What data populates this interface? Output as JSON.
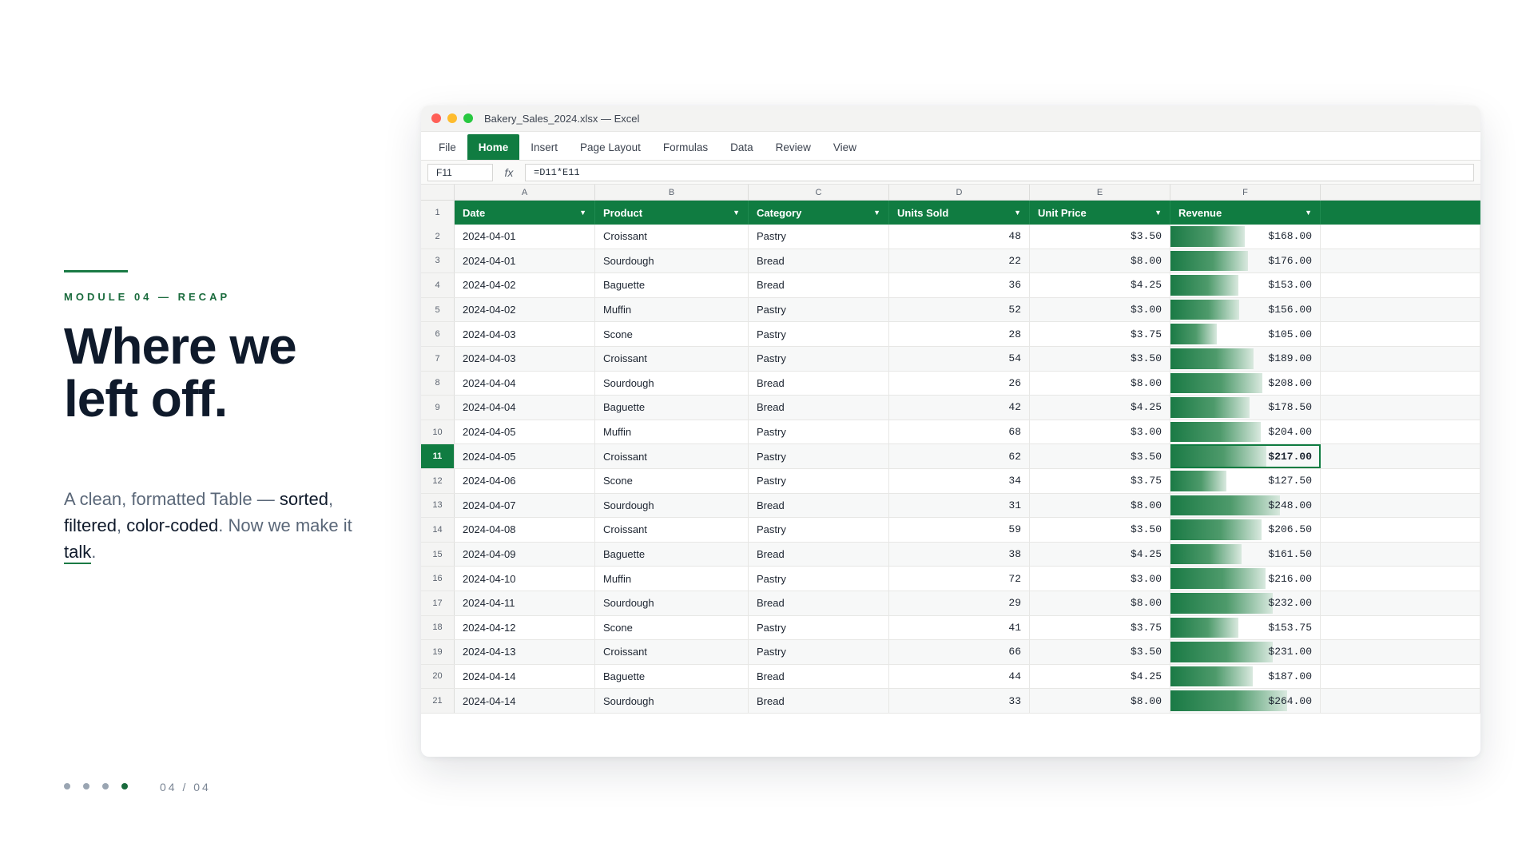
{
  "slide": {
    "eyebrow": "MODULE 04 — RECAP",
    "headline": "Where we left off.",
    "subtitle": {
      "p1": "A clean, formatted Table — ",
      "w1": "sorted",
      "p2": ", ",
      "w2": "filtered",
      "p3": ", ",
      "w3": "color-coded",
      "p4": ". Now we make it ",
      "w4": "talk",
      "p5": "."
    },
    "pager": "04 / 04",
    "total_slides": 4,
    "current_slide": 4
  },
  "window": {
    "title": "Bakery_Sales_2024.xlsx — Excel",
    "ribbon_tabs": [
      "File",
      "Home",
      "Insert",
      "Page Layout",
      "Formulas",
      "Data",
      "Review",
      "View"
    ],
    "active_tab": "Home",
    "namebox": "F11",
    "fx_label": "fx",
    "formula": "=D11*E11",
    "columns": [
      "A",
      "B",
      "C",
      "D",
      "E",
      "F"
    ],
    "headers": [
      "Date",
      "Product",
      "Category",
      "Units Sold",
      "Unit Price",
      "Revenue"
    ],
    "selected_row": 11,
    "accent_color": "#107c41",
    "rows": [
      {
        "n": 2,
        "date": "2024-04-01",
        "product": "Croissant",
        "category": "Pastry",
        "units": "48",
        "price": "$3.50",
        "revenue": "$168.00",
        "rv": 168
      },
      {
        "n": 3,
        "date": "2024-04-01",
        "product": "Sourdough",
        "category": "Bread",
        "units": "22",
        "price": "$8.00",
        "revenue": "$176.00",
        "rv": 176
      },
      {
        "n": 4,
        "date": "2024-04-02",
        "product": "Baguette",
        "category": "Bread",
        "units": "36",
        "price": "$4.25",
        "revenue": "$153.00",
        "rv": 153
      },
      {
        "n": 5,
        "date": "2024-04-02",
        "product": "Muffin",
        "category": "Pastry",
        "units": "52",
        "price": "$3.00",
        "revenue": "$156.00",
        "rv": 156
      },
      {
        "n": 6,
        "date": "2024-04-03",
        "product": "Scone",
        "category": "Pastry",
        "units": "28",
        "price": "$3.75",
        "revenue": "$105.00",
        "rv": 105
      },
      {
        "n": 7,
        "date": "2024-04-03",
        "product": "Croissant",
        "category": "Pastry",
        "units": "54",
        "price": "$3.50",
        "revenue": "$189.00",
        "rv": 189
      },
      {
        "n": 8,
        "date": "2024-04-04",
        "product": "Sourdough",
        "category": "Bread",
        "units": "26",
        "price": "$8.00",
        "revenue": "$208.00",
        "rv": 208
      },
      {
        "n": 9,
        "date": "2024-04-04",
        "product": "Baguette",
        "category": "Bread",
        "units": "42",
        "price": "$4.25",
        "revenue": "$178.50",
        "rv": 178.5
      },
      {
        "n": 10,
        "date": "2024-04-05",
        "product": "Muffin",
        "category": "Pastry",
        "units": "68",
        "price": "$3.00",
        "revenue": "$204.00",
        "rv": 204
      },
      {
        "n": 11,
        "date": "2024-04-05",
        "product": "Croissant",
        "category": "Pastry",
        "units": "62",
        "price": "$3.50",
        "revenue": "$217.00",
        "rv": 217
      },
      {
        "n": 12,
        "date": "2024-04-06",
        "product": "Scone",
        "category": "Pastry",
        "units": "34",
        "price": "$3.75",
        "revenue": "$127.50",
        "rv": 127.5
      },
      {
        "n": 13,
        "date": "2024-04-07",
        "product": "Sourdough",
        "category": "Bread",
        "units": "31",
        "price": "$8.00",
        "revenue": "$248.00",
        "rv": 248
      },
      {
        "n": 14,
        "date": "2024-04-08",
        "product": "Croissant",
        "category": "Pastry",
        "units": "59",
        "price": "$3.50",
        "revenue": "$206.50",
        "rv": 206.5
      },
      {
        "n": 15,
        "date": "2024-04-09",
        "product": "Baguette",
        "category": "Bread",
        "units": "38",
        "price": "$4.25",
        "revenue": "$161.50",
        "rv": 161.5
      },
      {
        "n": 16,
        "date": "2024-04-10",
        "product": "Muffin",
        "category": "Pastry",
        "units": "72",
        "price": "$3.00",
        "revenue": "$216.00",
        "rv": 216
      },
      {
        "n": 17,
        "date": "2024-04-11",
        "product": "Sourdough",
        "category": "Bread",
        "units": "29",
        "price": "$8.00",
        "revenue": "$232.00",
        "rv": 232
      },
      {
        "n": 18,
        "date": "2024-04-12",
        "product": "Scone",
        "category": "Pastry",
        "units": "41",
        "price": "$3.75",
        "revenue": "$153.75",
        "rv": 153.75
      },
      {
        "n": 19,
        "date": "2024-04-13",
        "product": "Croissant",
        "category": "Pastry",
        "units": "66",
        "price": "$3.50",
        "revenue": "$231.00",
        "rv": 231
      },
      {
        "n": 20,
        "date": "2024-04-14",
        "product": "Baguette",
        "category": "Bread",
        "units": "44",
        "price": "$4.25",
        "revenue": "$187.00",
        "rv": 187
      },
      {
        "n": 21,
        "date": "2024-04-14",
        "product": "Sourdough",
        "category": "Bread",
        "units": "33",
        "price": "$8.00",
        "revenue": "$264.00",
        "rv": 264
      }
    ]
  }
}
